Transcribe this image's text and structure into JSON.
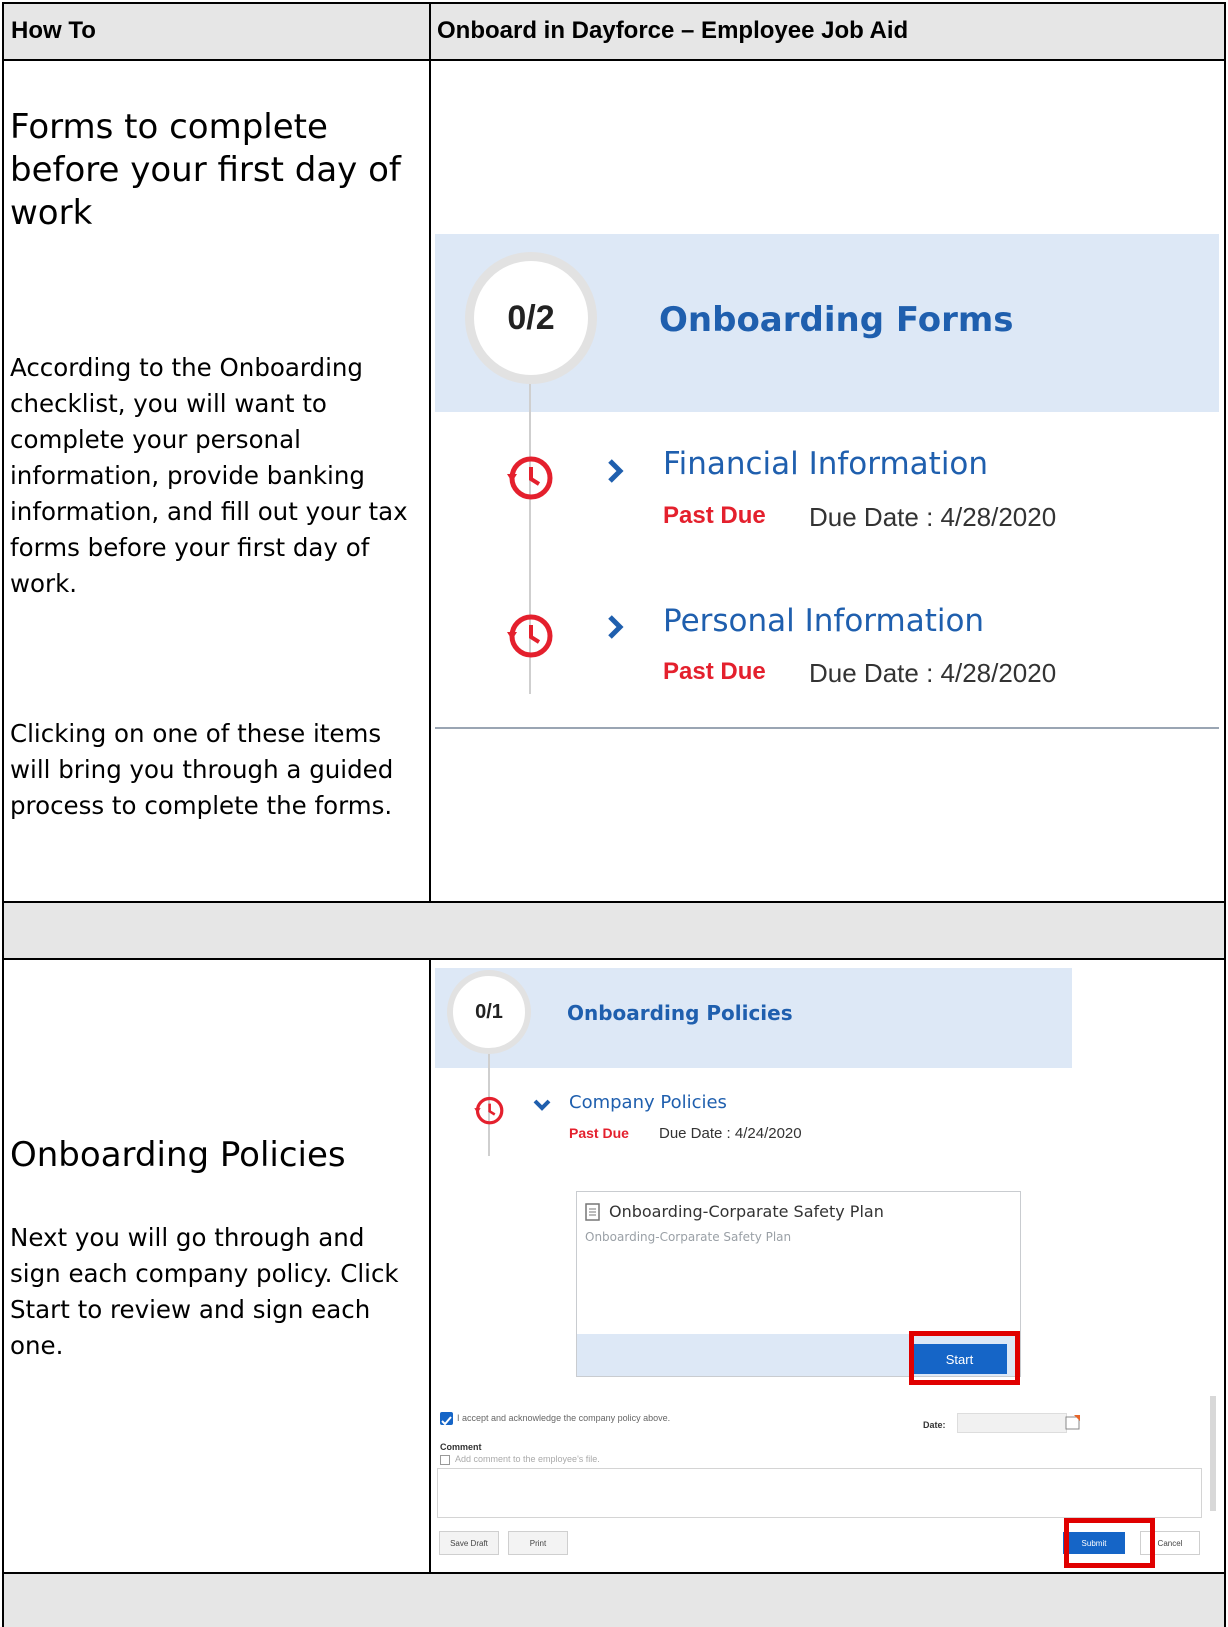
{
  "header": {
    "left": "How To",
    "right": "Onboard in Dayforce – Employee Job Aid"
  },
  "section1": {
    "title": "Forms to complete before your first day of work",
    "para1": "According to the Onboarding checklist, you will want to complete your personal information, provide banking information, and fill out your tax forms before your first day of work.",
    "para2": "Clicking on one of these items will bring you through a guided process to complete the forms.",
    "screenshot": {
      "progress": "0/2",
      "heading": "Onboarding Forms",
      "items": [
        {
          "title": "Financial Information",
          "status": "Past Due",
          "due": "Due Date : 4/28/2020"
        },
        {
          "title": "Personal Information",
          "status": "Past Due",
          "due": "Due Date : 4/28/2020"
        }
      ]
    }
  },
  "section2": {
    "title": "Onboarding Policies",
    "para1": "Next you will go through and sign each company policy. Click Start to review and sign each one.",
    "screenshot": {
      "progress": "0/1",
      "heading": "Onboarding Policies",
      "item": {
        "title": "Company Policies",
        "status": "Past Due",
        "due": "Due Date : 4/24/2020"
      },
      "card_title": "Onboarding-Corparate Safety Plan",
      "card_subtitle": "Onboarding-Corparate Safety Plan",
      "start_label": "Start",
      "accept_text": "I accept and acknowledge the company policy above.",
      "date_label": "Date:",
      "comment_label": "Comment",
      "comment_hint": "Add comment to the employee's file.",
      "save_draft_label": "Save Draft",
      "print_label": "Print",
      "submit_label": "Submit",
      "cancel_label": "Cancel"
    }
  },
  "colors": {
    "accent_blue": "#1f5fae",
    "past_due_red": "#e4202d",
    "highlight_red": "#e00000",
    "panel_blue": "#dde8f6"
  }
}
